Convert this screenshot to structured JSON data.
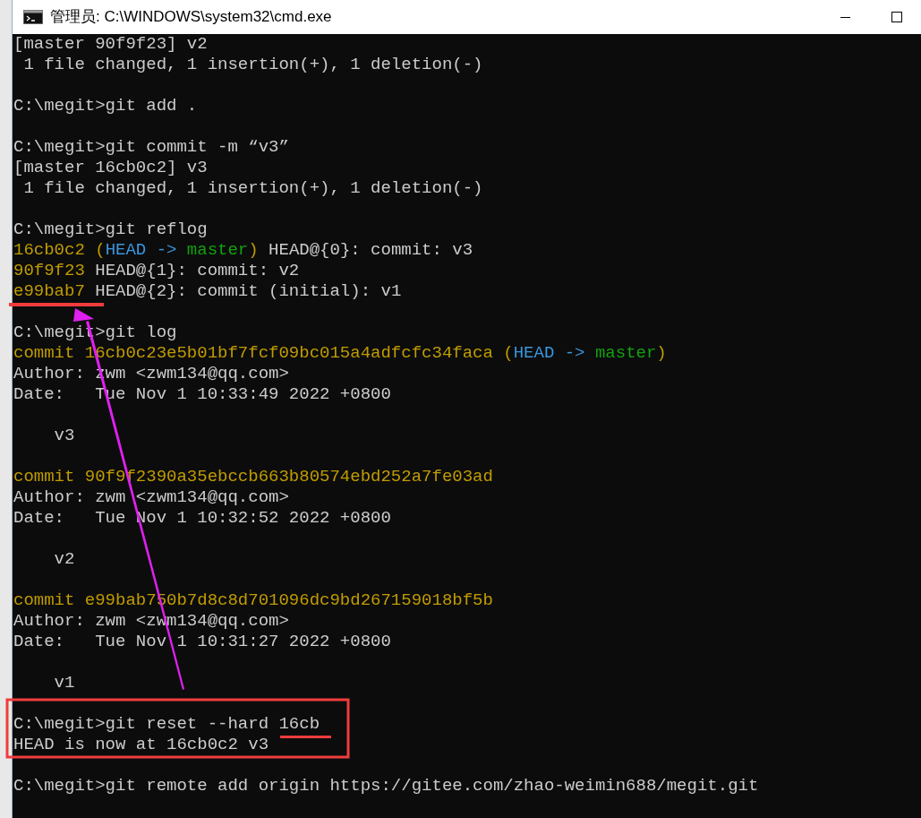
{
  "window": {
    "title": "管理员: C:\\WINDOWS\\system32\\cmd.exe"
  },
  "lines": [
    {
      "kind": "text",
      "segments": [
        {
          "text": "[master 90f9f23] v2",
          "color": "#cccccc"
        }
      ]
    },
    {
      "kind": "text",
      "segments": [
        {
          "text": " 1 file changed, 1 insertion(+), 1 deletion(-)",
          "color": "#cccccc"
        }
      ]
    },
    {
      "kind": "blank"
    },
    {
      "kind": "text",
      "segments": [
        {
          "text": "C:\\megit>git add .",
          "color": "#cccccc"
        }
      ]
    },
    {
      "kind": "blank"
    },
    {
      "kind": "text",
      "segments": [
        {
          "text": "C:\\megit>git commit -m “v3”",
          "color": "#cccccc"
        }
      ]
    },
    {
      "kind": "text",
      "segments": [
        {
          "text": "[master 16cb0c2] v3",
          "color": "#cccccc"
        }
      ]
    },
    {
      "kind": "text",
      "segments": [
        {
          "text": " 1 file changed, 1 insertion(+), 1 deletion(-)",
          "color": "#cccccc"
        }
      ]
    },
    {
      "kind": "blank"
    },
    {
      "kind": "text",
      "segments": [
        {
          "text": "C:\\megit>git reflog",
          "color": "#cccccc"
        }
      ]
    },
    {
      "kind": "text",
      "segments": [
        {
          "text": "16cb0c2 ",
          "color": "#c19c00"
        },
        {
          "text": "(",
          "color": "#c19c00"
        },
        {
          "text": "HEAD -> ",
          "color": "#3a96dd"
        },
        {
          "text": "master",
          "color": "#13a10e"
        },
        {
          "text": ")",
          "color": "#c19c00"
        },
        {
          "text": " HEAD@{0}: commit: v3",
          "color": "#cccccc"
        }
      ]
    },
    {
      "kind": "text",
      "segments": [
        {
          "text": "90f9f23",
          "color": "#c19c00"
        },
        {
          "text": " HEAD@{1}: commit: v2",
          "color": "#cccccc"
        }
      ]
    },
    {
      "kind": "text",
      "segments": [
        {
          "text": "e99bab7",
          "color": "#c19c00"
        },
        {
          "text": " HEAD@{2}: commit (initial): v1",
          "color": "#cccccc"
        }
      ]
    },
    {
      "kind": "blank"
    },
    {
      "kind": "text",
      "segments": [
        {
          "text": "C:\\megit>git log",
          "color": "#cccccc"
        }
      ]
    },
    {
      "kind": "text",
      "segments": [
        {
          "text": "commit 16cb0c23e5b01bf7fcf09bc015a4adfcfc34faca (",
          "color": "#c19c00"
        },
        {
          "text": "HEAD -> ",
          "color": "#3a96dd"
        },
        {
          "text": "master",
          "color": "#13a10e"
        },
        {
          "text": ")",
          "color": "#c19c00"
        }
      ]
    },
    {
      "kind": "text",
      "segments": [
        {
          "text": "Author: zwm <zwm134@qq.com>",
          "color": "#cccccc"
        }
      ]
    },
    {
      "kind": "text",
      "segments": [
        {
          "text": "Date:   Tue Nov 1 10:33:49 2022 +0800",
          "color": "#cccccc"
        }
      ]
    },
    {
      "kind": "blank"
    },
    {
      "kind": "text",
      "segments": [
        {
          "text": "    v3",
          "color": "#cccccc"
        }
      ]
    },
    {
      "kind": "blank"
    },
    {
      "kind": "text",
      "segments": [
        {
          "text": "commit 90f9f2390a35ebccb663b80574ebd252a7fe03ad",
          "color": "#c19c00"
        }
      ]
    },
    {
      "kind": "text",
      "segments": [
        {
          "text": "Author: zwm <zwm134@qq.com>",
          "color": "#cccccc"
        }
      ]
    },
    {
      "kind": "text",
      "segments": [
        {
          "text": "Date:   Tue Nov 1 10:32:52 2022 +0800",
          "color": "#cccccc"
        }
      ]
    },
    {
      "kind": "blank"
    },
    {
      "kind": "text",
      "segments": [
        {
          "text": "    v2",
          "color": "#cccccc"
        }
      ]
    },
    {
      "kind": "blank"
    },
    {
      "kind": "text",
      "segments": [
        {
          "text": "commit e99bab750b7d8c8d701096dc9bd267159018bf5b",
          "color": "#c19c00"
        }
      ]
    },
    {
      "kind": "text",
      "segments": [
        {
          "text": "Author: zwm <zwm134@qq.com>",
          "color": "#cccccc"
        }
      ]
    },
    {
      "kind": "text",
      "segments": [
        {
          "text": "Date:   Tue Nov 1 10:31:27 2022 +0800",
          "color": "#cccccc"
        }
      ]
    },
    {
      "kind": "blank"
    },
    {
      "kind": "text",
      "segments": [
        {
          "text": "    v1",
          "color": "#cccccc"
        }
      ]
    },
    {
      "kind": "blank"
    },
    {
      "kind": "text",
      "segments": [
        {
          "text": "C:\\megit>git reset --hard 16cb",
          "color": "#cccccc"
        }
      ]
    },
    {
      "kind": "text",
      "segments": [
        {
          "text": "HEAD is now at 16cb0c2 v3",
          "color": "#cccccc"
        }
      ]
    },
    {
      "kind": "blank"
    },
    {
      "kind": "text",
      "segments": [
        {
          "text": "C:\\megit>git remote add origin https://gitee.com/zhao-weimin688/megit.git",
          "color": "#cccccc"
        }
      ]
    }
  ]
}
